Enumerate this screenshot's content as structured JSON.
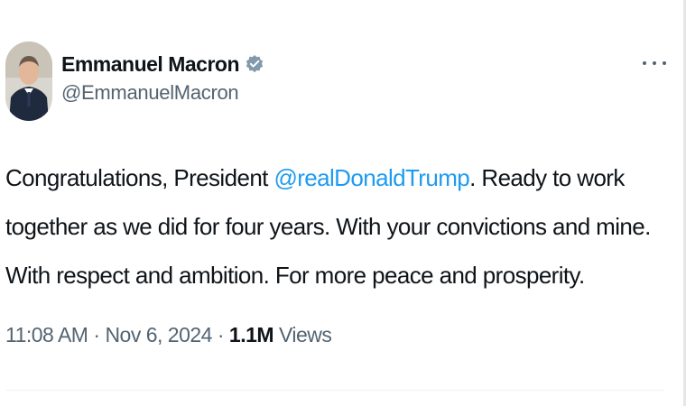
{
  "tweet": {
    "author": {
      "display_name": "Emmanuel Macron",
      "handle": "@EmmanuelMacron",
      "verified_icon": "verified-badge-gray"
    },
    "more_icon": "ellipsis-icon",
    "text": {
      "part1": "Congratulations, President ",
      "mention": "@realDonaldTrump",
      "part2": ". Ready to work together as we did for four years. With your convictions and mine. With respect and ambition. For more peace and prosperity."
    },
    "meta": {
      "time": "11:08 AM",
      "separator": " · ",
      "date": "Nov 6, 2024",
      "views_count": "1.1M",
      "views_label": "Views"
    }
  },
  "colors": {
    "text": "#0f1419",
    "secondary": "#536471",
    "link": "#1d9bf0",
    "verified": "#829aab"
  }
}
